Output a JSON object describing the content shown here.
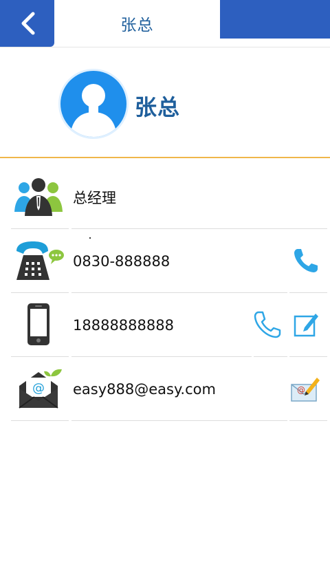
{
  "header": {
    "title": "张总"
  },
  "profile": {
    "name": "张总"
  },
  "rows": [
    {
      "icon": "people-icon",
      "text": "总经理"
    },
    {
      "icon": "telephone-icon",
      "text": "0830-888888"
    },
    {
      "icon": "mobile-phone-icon",
      "text": "18888888888"
    },
    {
      "icon": "mail-envelope-icon",
      "text": "easy888@easy.com"
    }
  ],
  "colors": {
    "brand_blue": "#2d5fbf",
    "title_blue": "#1f5f9c",
    "accent_blue": "#1f8fec",
    "divider_orange": "#f0b64a"
  }
}
